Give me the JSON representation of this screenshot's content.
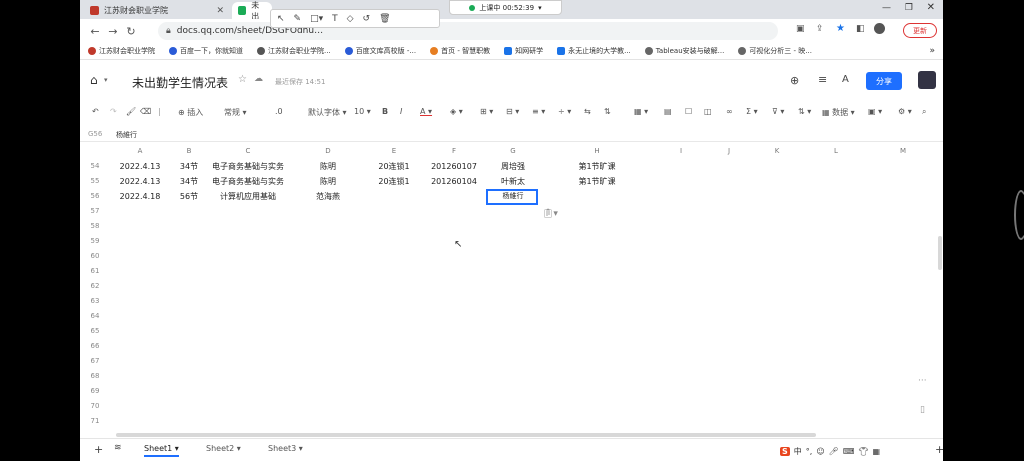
{
  "browser": {
    "tabs": [
      {
        "label": "江苏财会职业学院",
        "active": false
      },
      {
        "label": "未出",
        "active": true
      }
    ],
    "url": "docs.qq.com/sheet/DSGFOdhu…",
    "update_button": "更新",
    "bookmarks": [
      "江苏财会职业学院",
      "百度一下，你就知道",
      "江苏财会职业学院...",
      "百度文库高校版 -...",
      "首页 - 智慧职教",
      "知网研学",
      "永无止境的大学教...",
      "Tableau安装与破解...",
      "可视化分析三 - 映..."
    ]
  },
  "meeting": {
    "label": "上课中 00:52:39"
  },
  "doc": {
    "title": "未出勤学生情况表",
    "save_status": "最近保存 14:51",
    "share_label": "分享"
  },
  "toolbar": {
    "insert": "插入",
    "format": "常规",
    "decimals": ".0",
    "font": "默认字体",
    "size": "10",
    "bold": "B",
    "italic": "I",
    "data": "数据"
  },
  "formula_bar": {
    "cell_ref": "G56",
    "value": "杨維行"
  },
  "columns": [
    "A",
    "B",
    "C",
    "D",
    "E",
    "F",
    "G",
    "H",
    "I",
    "J",
    "K",
    "L",
    "M"
  ],
  "rows": [
    {
      "n": "54",
      "cells": [
        "2022.4.13",
        "34节",
        "电子商务基础与实务",
        "陈明",
        "20连锁1",
        "201260107",
        "周培强",
        "第1节旷课"
      ]
    },
    {
      "n": "55",
      "cells": [
        "2022.4.13",
        "34节",
        "电子商务基础与实务",
        "陈明",
        "20连锁1",
        "201260104",
        "叶新太",
        "第1节旷课"
      ]
    },
    {
      "n": "56",
      "cells": [
        "2022.4.18",
        "56节",
        "计算机应用基础",
        "范海燕",
        "",
        "",
        "杨維行",
        ""
      ]
    },
    {
      "n": "57"
    },
    {
      "n": "58"
    },
    {
      "n": "59"
    },
    {
      "n": "60"
    },
    {
      "n": "61"
    },
    {
      "n": "62"
    },
    {
      "n": "63"
    },
    {
      "n": "64"
    },
    {
      "n": "65"
    },
    {
      "n": "66"
    },
    {
      "n": "67"
    },
    {
      "n": "68"
    },
    {
      "n": "69"
    },
    {
      "n": "70"
    },
    {
      "n": "71"
    }
  ],
  "sheets": [
    "Sheet1",
    "Sheet2",
    "Sheet3"
  ],
  "ime": {
    "label": "中"
  }
}
